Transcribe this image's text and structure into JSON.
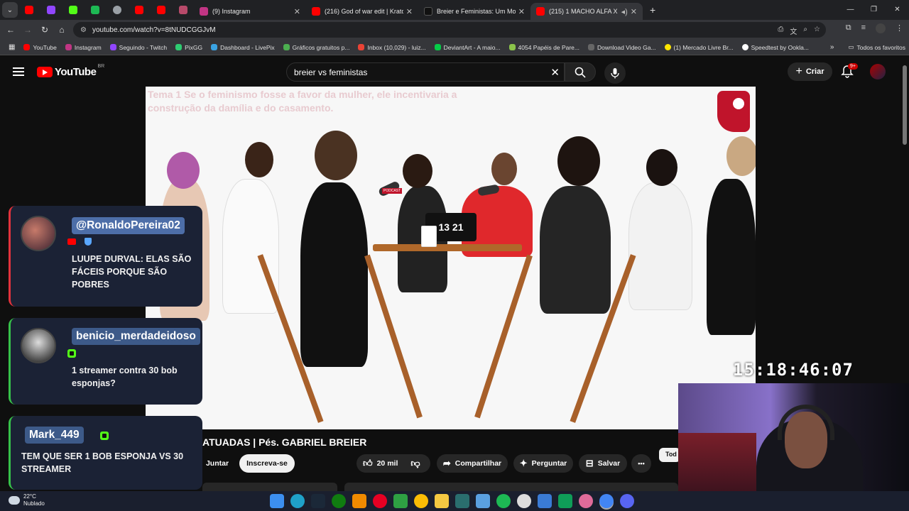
{
  "browser": {
    "pinned_tabs": [
      "youtube",
      "twitch",
      "kick",
      "kick2",
      "chrome",
      "youtube2",
      "youtube3",
      "generic"
    ],
    "tabs": [
      {
        "title": "(9) Instagram",
        "favicon": "#c13584",
        "active": false
      },
      {
        "title": "(216) God of war edit | Kratos v",
        "favicon": "#ff0000",
        "active": false
      },
      {
        "title": "Breier e Feministas: Um Momen",
        "favicon": "#111111",
        "active": false
      },
      {
        "title": "(215) 1 MACHO ALFA X 25 |",
        "favicon": "#ff0000",
        "active": true
      }
    ],
    "new_tab": "+",
    "url": "youtube.com/watch?v=8tNUDCGGJvM",
    "bookmarks": [
      {
        "label": "YouTube",
        "color": "#ff0000"
      },
      {
        "label": "Instagram",
        "color": "#c13584"
      },
      {
        "label": "Seguindo - Twitch",
        "color": "#9146ff"
      },
      {
        "label": "PixGG",
        "color": "#2ecc71"
      },
      {
        "label": "Dashboard - LivePix",
        "color": "#3aa3e3"
      },
      {
        "label": "Gráficos gratuitos p...",
        "color": "#4caf50"
      },
      {
        "label": "Inbox (10,029) - luiz...",
        "color": "#ea4335"
      },
      {
        "label": "DeviantArt - A maio...",
        "color": "#05cc47"
      },
      {
        "label": "4054 Papéis de Pare...",
        "color": "#8bc34a"
      },
      {
        "label": "Download Video Ga...",
        "color": "#444444"
      },
      {
        "label": "(1) Mercado Livre Br...",
        "color": "#ffe600"
      },
      {
        "label": "Speedtest by Ookla...",
        "color": "#ffffff"
      }
    ],
    "all_favorites": "Todos os favoritos"
  },
  "youtube": {
    "logo_text": "YouTube",
    "region": "BR",
    "search_value": "breier vs feministas",
    "create_label": "Criar",
    "notif_count": "9+",
    "video": {
      "theme_text": "Tema  1  Se o feminismo fosse a favor da mulher, ele incentivaria a construção da damília e do casamento.",
      "clock": "13 21",
      "mic_tag": "PODCAST"
    },
    "title_fragment": "ATUADAS | Pés. GABRIEL BREIER",
    "join_label": "Juntar",
    "subscribe_label": "Inscreva-se",
    "like_count": "20 mil",
    "share_label": "Compartilhar",
    "ask_label": "Perguntar",
    "save_label": "Salvar",
    "more_label": "•••",
    "filter_chip": "Tod"
  },
  "overlay": {
    "chat": [
      {
        "user": "@RonaldoPereira02",
        "message": "LUUPE DURVAL: ELAS SÃO FÁCEIS PORQUE SÃO POBRES",
        "accent": "#e2323c",
        "name_bg": "#4d6ea8",
        "name_color": "#ffffff",
        "badges": [
          "youtube",
          "shield"
        ]
      },
      {
        "user": "benicio_merdadeidoso",
        "message": "1 streamer contra 30 bob esponjas?",
        "accent": "#37c24a",
        "name_bg": "#3d5a89",
        "name_color": "#ffffff",
        "badges": [
          "kick"
        ]
      },
      {
        "user": "Mark_449",
        "message": "TEM QUE SER 1 BOB ESPONJA VS 30 STREAMER",
        "accent": "#37c24a",
        "name_bg": "#3d5a89",
        "name_color": "#ffffff",
        "badges": [
          "kick"
        ]
      }
    ],
    "stream_time": "15:18:46:07"
  },
  "taskbar": {
    "temperature": "22°C",
    "weather": "Nublado",
    "apps": [
      "windows",
      "edge",
      "steam",
      "xbox",
      "vlc",
      "pinterest",
      "bet",
      "chrome",
      "explorer",
      "app1",
      "notepad",
      "spotify",
      "github",
      "display",
      "app2",
      "photos",
      "chrome2",
      "discord"
    ]
  }
}
